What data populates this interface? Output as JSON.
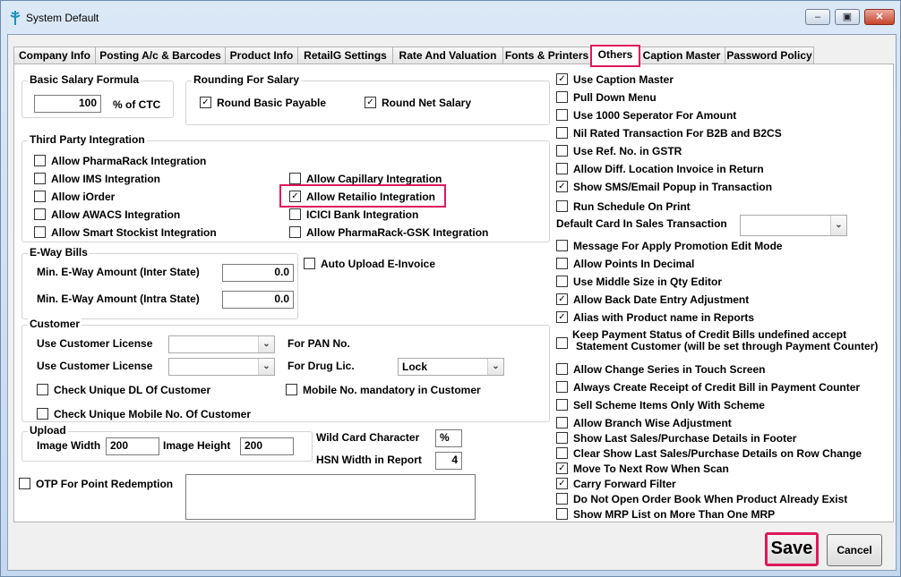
{
  "window": {
    "title": "System Default",
    "minimize_glyph": "–",
    "restore_glyph": "▣",
    "close_glyph": "✕"
  },
  "tabs": [
    {
      "label": "Company Info"
    },
    {
      "label": "Posting A/c & Barcodes"
    },
    {
      "label": "Product Info"
    },
    {
      "label": "RetailG Settings"
    },
    {
      "label": "Rate And Valuation"
    },
    {
      "label": "Fonts & Printers"
    },
    {
      "label": "Others"
    },
    {
      "label": "Caption Master"
    },
    {
      "label": "Password Policy"
    }
  ],
  "active_tab": "Others",
  "highlight_color": "#e0185a",
  "check_glyph": "✓",
  "basic_salary": {
    "title": "Basic Salary Formula",
    "value": "100",
    "unit": "% of CTC"
  },
  "rounding": {
    "title": "Rounding For Salary",
    "round_basic": {
      "label": "Round Basic Payable",
      "checked": true
    },
    "round_net": {
      "label": "Round Net Salary",
      "checked": true
    }
  },
  "third_party": {
    "title": "Third Party Integration",
    "items": [
      {
        "label": "Allow PharmaRack Integration",
        "checked": false
      },
      {
        "label": "Allow IMS Integration",
        "checked": false
      },
      {
        "label": "Allow iOrder",
        "checked": false
      },
      {
        "label": "Allow AWACS Integration",
        "checked": false
      },
      {
        "label": "Allow Smart Stockist Integration",
        "checked": false
      },
      {
        "label": "Allow Capillary Integration",
        "checked": false
      },
      {
        "label": "Allow Retailio Integration",
        "checked": true
      },
      {
        "label": "ICICI Bank Integration",
        "checked": false
      },
      {
        "label": "Allow PharmaRack-GSK Integration",
        "checked": false
      }
    ]
  },
  "eway": {
    "title": "E-Way Bills",
    "inter_label": "Min. E-Way Amount (Inter State)",
    "inter_value": "0.0",
    "intra_label": "Min. E-Way Amount (Intra State)",
    "intra_value": "0.0"
  },
  "auto_upload": {
    "label": "Auto Upload E-Invoice",
    "checked": false
  },
  "customer": {
    "title": "Customer",
    "license_label": "Use Customer License",
    "license_value": "",
    "pan_label": "For PAN No.",
    "license2_label": "Use Customer License",
    "license2_value": "",
    "drug_label": "For Drug Lic.",
    "drug_value": "Lock",
    "unique_dl": {
      "label": "Check Unique DL Of Customer",
      "checked": false
    },
    "mobile_mandatory": {
      "label": "Mobile No. mandatory in Customer",
      "checked": false
    },
    "unique_mobile": {
      "label": "Check Unique Mobile No. Of Customer",
      "checked": false
    }
  },
  "upload": {
    "title": "Upload",
    "width_label": "Image Width",
    "width_value": "200",
    "height_label": "Image Height",
    "height_value": "200"
  },
  "wildcard": {
    "label": "Wild Card Character",
    "value": "%"
  },
  "hsn": {
    "label": "HSN Width in Report",
    "value": "4"
  },
  "otp": {
    "label": "OTP For Point Redemption",
    "checked": false
  },
  "right_options": [
    {
      "label": "Use Caption Master",
      "checked": true
    },
    {
      "label": "Pull Down Menu",
      "checked": false
    },
    {
      "label": "Use 1000 Seperator For Amount",
      "checked": false
    },
    {
      "label": "Nil Rated Transaction For B2B and B2CS",
      "checked": false
    },
    {
      "label": "Use Ref. No. in GSTR",
      "checked": false
    },
    {
      "label": "Allow Diff. Location Invoice in Return",
      "checked": false
    },
    {
      "label": "Show SMS/Email Popup in Transaction",
      "checked": true
    },
    {
      "label": "Run Schedule On Print",
      "checked": false
    }
  ],
  "default_card": {
    "label": "Default Card In Sales Transaction",
    "value": ""
  },
  "right_options2": [
    {
      "label": "Message For Apply Promotion Edit Mode",
      "checked": false
    },
    {
      "label": "Allow Points In Decimal",
      "checked": false
    },
    {
      "label": "Use Middle Size in Qty Editor",
      "checked": false
    },
    {
      "label": "Allow Back Date Entry Adjustment",
      "checked": true
    },
    {
      "label": "Alias with Product name in Reports",
      "checked": true
    }
  ],
  "keep_payment": {
    "line1": "Keep Payment Status of Credit Bills undefined accept",
    "line2": "Statement Customer (will be set through Payment Counter)",
    "checked": false
  },
  "right_options3": [
    {
      "label": "Allow Change Series in Touch Screen",
      "checked": false
    },
    {
      "label": "Always Create Receipt of Credit Bill in Payment Counter",
      "checked": false
    },
    {
      "label": "Sell Scheme Items Only With Scheme",
      "checked": false
    },
    {
      "label": "Allow Branch Wise Adjustment",
      "checked": false
    },
    {
      "label": "Show Last Sales/Purchase Details in Footer",
      "checked": false
    },
    {
      "label": "Clear Show Last Sales/Purchase Details on Row Change",
      "checked": false
    },
    {
      "label": "Move To Next Row When Scan",
      "checked": true
    },
    {
      "label": "Carry Forward Filter",
      "checked": true
    },
    {
      "label": "Do Not Open Order Book When Product Already Exist",
      "checked": false
    },
    {
      "label": "Show MRP List on More Than One MRP",
      "checked": false
    }
  ],
  "buttons": {
    "save": "Save",
    "cancel": "Cancel"
  }
}
